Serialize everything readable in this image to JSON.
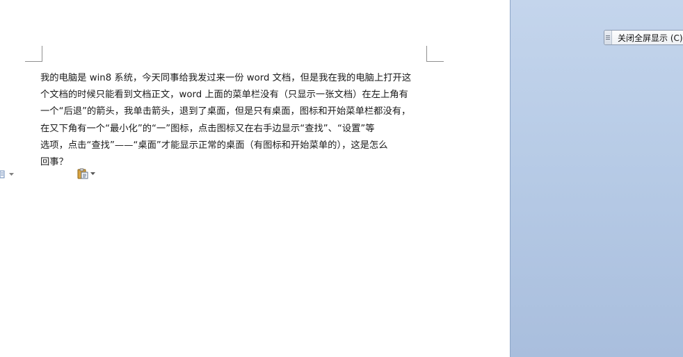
{
  "document": {
    "lines": [
      "我的电脑是 win8 系统，今天同事给我发过来一份 word 文档，但是我在我的电脑上打开这",
      "个文档的时候只能看到文档正文，word 上面的菜单栏没有（只显示一张文档）在左上角有",
      "一个“后退”的箭头，我单击箭头，退到了桌面，但是只有桌面，图标和开始菜单栏都没有，",
      "在又下角有一个“最小化”的“一”图标，点击图标又在右手边显示“查找”、“设置”等",
      "选项，点击“查找”——“桌面”才能显示正常的桌面（有图标和开始菜单的），这是怎么",
      "回事？"
    ]
  },
  "toolbar": {
    "close_fullscreen_label": "关闭全屏显示 (C)",
    "grip_icon": "grip-handle-icon",
    "paste_icon": "clipboard-paste-icon"
  },
  "colors": {
    "panel_top": "#c4d5ec",
    "panel_bottom": "#a9bedd",
    "page": "#ffffff",
    "text": "#1a1a1a"
  }
}
